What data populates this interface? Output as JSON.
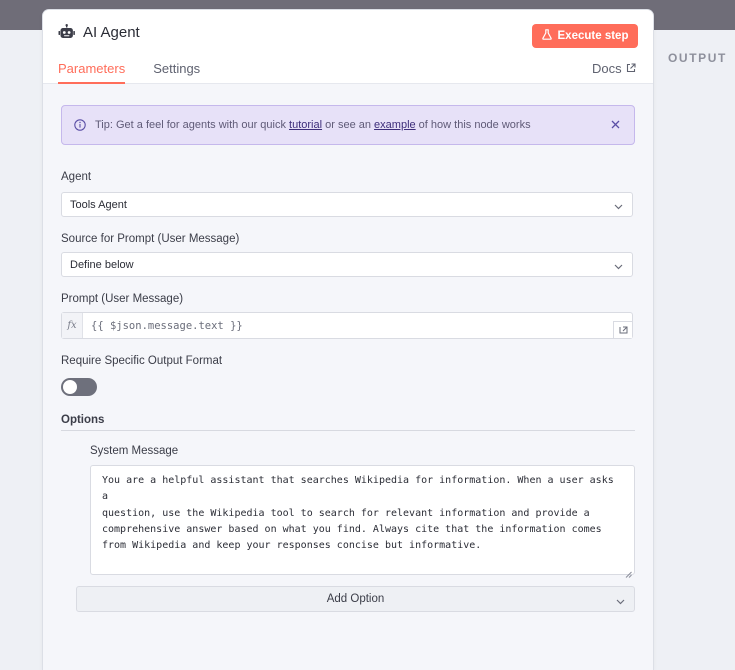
{
  "panel": {
    "title": "AI Agent",
    "execute_label": "Execute step",
    "tabs": [
      {
        "label": "Parameters",
        "active": true
      },
      {
        "label": "Settings",
        "active": false
      }
    ],
    "docs_label": "Docs"
  },
  "side": {
    "output_label": "OUTPUT"
  },
  "tip": {
    "prefix": "Tip: Get a feel for agents with our quick ",
    "link1": "tutorial",
    "middle": " or see an ",
    "link2": "example",
    "suffix": " of how this node works"
  },
  "fields": {
    "agent": {
      "label": "Agent",
      "value": "Tools Agent"
    },
    "prompt_source": {
      "label": "Source for Prompt (User Message)",
      "value": "Define below"
    },
    "prompt": {
      "label": "Prompt (User Message)",
      "fx": "fx",
      "value": "{{ $json.message.text }}"
    },
    "output_format": {
      "label": "Require Specific Output Format",
      "enabled": false
    }
  },
  "options": {
    "title": "Options",
    "system_message": {
      "label": "System Message",
      "value": "You are a helpful assistant that searches Wikipedia for information. When a user asks a\nquestion, use the Wikipedia tool to search for relevant information and provide a\ncomprehensive answer based on what you find. Always cite that the information comes\nfrom Wikipedia and keep your responses concise but informative."
    },
    "add_option_label": "Add Option"
  },
  "colors": {
    "accent": "#ff6d5a",
    "tip_bg": "#e7e1f8",
    "toggle_off": "#6e707c"
  }
}
